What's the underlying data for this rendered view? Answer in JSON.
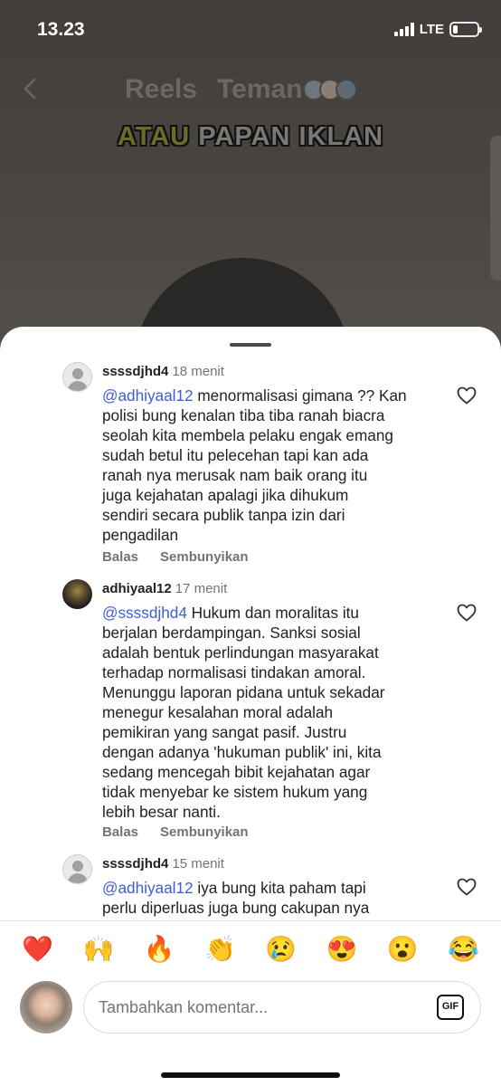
{
  "status_bar": {
    "time": "13.23",
    "network": "LTE",
    "battery_level": 0.15
  },
  "top_nav": {
    "tabs": [
      {
        "label": "Reels"
      },
      {
        "label": "Teman"
      }
    ]
  },
  "reel": {
    "caption_part1": "ATAU",
    "caption_part2": "PAPAN IKLAN",
    "caption_colors": {
      "part1": "#e5e043",
      "part2": "#ffffff"
    }
  },
  "comments": [
    {
      "username": "ssssdjhd4",
      "time": "18 menit",
      "mention": "@adhiyaal12",
      "lines": [
        " menormalisasi gimana ?? Kan",
        "polisi bung kenalan tiba tiba ranah biacra",
        "seolah kita membela pelaku engak emang",
        "sudah betul itu pelecehan tapi kan ada",
        "ranah nya merusak nam baik orang itu",
        "juga kejahatan apalagi jika dihukum",
        "sendiri secara publik tanpa izin dari",
        "pengadilan"
      ],
      "reply_label": "Balas",
      "hide_label": "Sembunyikan",
      "avatar": "default-avatar-icon"
    },
    {
      "username": "adhiyaal12",
      "time": "17 menit",
      "mention": "@ssssdjhd4",
      "lines": [
        " Hukum dan moralitas itu",
        "berjalan berdampingan. Sanksi sosial",
        "adalah bentuk perlindungan masyarakat",
        "terhadap normalisasi tindakan amoral.",
        "Menunggu laporan pidana untuk sekadar",
        "menegur kesalahan moral adalah",
        "pemikiran yang sangat pasif. Justru",
        "dengan adanya 'hukuman publik' ini, kita",
        "sedang mencegah bibit kejahatan agar",
        "tidak menyebar ke sistem hukum yang",
        "lebih besar nanti."
      ],
      "reply_label": "Balas",
      "hide_label": "Sembunyikan",
      "avatar": "profile-photo"
    },
    {
      "username": "ssssdjhd4",
      "time": "15 menit",
      "mention": "@adhiyaal12",
      "lines": [
        " iya bung kita paham tapi",
        "perlu diperluas juga bung cakupan nya"
      ],
      "avatar": "default-avatar-icon"
    }
  ],
  "reactions": [
    "❤️",
    "🙌",
    "🔥",
    "👏",
    "😢",
    "😍",
    "😮",
    "😂"
  ],
  "composer": {
    "placeholder": "Tambahkan komentar...",
    "gif_label": "GIF"
  },
  "colors": {
    "mention": "#3d5ed6",
    "meta": "#737373"
  }
}
